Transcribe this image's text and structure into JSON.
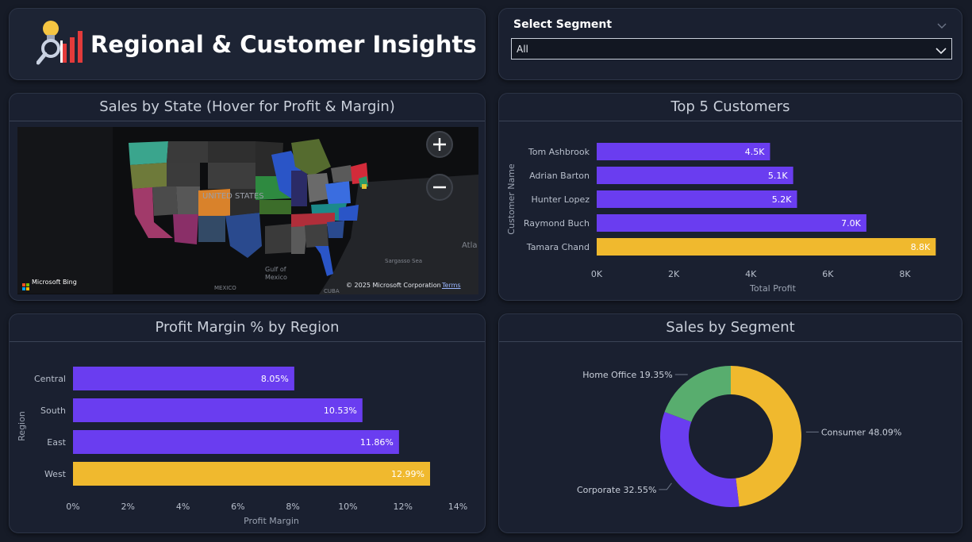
{
  "header": {
    "title": "Regional & Customer Insights",
    "logo_icon": "insights-logo-icon"
  },
  "slicer": {
    "label": "Select Segment",
    "value": "All",
    "icon": "chevron-down-icon"
  },
  "map": {
    "title": "Sales by State (Hover for Profit & Margin)",
    "labels": {
      "country": "UNITED STATES",
      "gulf": "Gulf of\nMexico",
      "mexico": "MEXICO",
      "cuba": "CUBA",
      "sargasso": "Sargasso Sea",
      "atlantic": "Atla"
    },
    "brand": "Microsoft Bing",
    "copyright": "© 2025 Microsoft Corporation",
    "terms": "Terms",
    "zoom_in_icon": "plus-icon",
    "zoom_out_icon": "minus-icon"
  },
  "chart_data": [
    {
      "type": "bar",
      "orientation": "horizontal",
      "title": "Top 5 Customers",
      "xlabel": "Total Profit",
      "ylabel": "Customer Name",
      "categories": [
        "Tom Ashbrook",
        "Adrian Barton",
        "Hunter Lopez",
        "Raymond Buch",
        "Tamara Chand"
      ],
      "values": [
        4500,
        5100,
        5200,
        7000,
        8800
      ],
      "data_labels": [
        "4.5K",
        "5.1K",
        "5.2K",
        "7.0K",
        "8.8K"
      ],
      "xlim": [
        0,
        9000
      ],
      "ticks": [
        0,
        2000,
        4000,
        6000,
        8000
      ],
      "tick_labels": [
        "0K",
        "2K",
        "4K",
        "6K",
        "8K"
      ],
      "colors": [
        "#6a3df0",
        "#6a3df0",
        "#6a3df0",
        "#6a3df0",
        "#f0b92e"
      ]
    },
    {
      "type": "bar",
      "orientation": "horizontal",
      "title": "Profit Margin % by Region",
      "xlabel": "Profit Margin",
      "ylabel": "Region",
      "categories": [
        "Central",
        "South",
        "East",
        "West"
      ],
      "values": [
        8.05,
        10.53,
        11.86,
        12.99
      ],
      "data_labels": [
        "8.05%",
        "10.53%",
        "11.86%",
        "12.99%"
      ],
      "xlim": [
        0,
        14
      ],
      "ticks": [
        0,
        2,
        4,
        6,
        8,
        10,
        12,
        14
      ],
      "tick_labels": [
        "0%",
        "2%",
        "4%",
        "6%",
        "8%",
        "10%",
        "12%",
        "14%"
      ],
      "colors": [
        "#6a3df0",
        "#6a3df0",
        "#6a3df0",
        "#f0b92e"
      ]
    },
    {
      "type": "pie",
      "variant": "donut",
      "title": "Sales by Segment",
      "categories": [
        "Consumer",
        "Corporate",
        "Home Office"
      ],
      "values": [
        48.09,
        32.55,
        19.35
      ],
      "data_labels": [
        "Consumer 48.09%",
        "Corporate 32.55%",
        "Home Office 19.35%"
      ],
      "colors": [
        "#f0b92e",
        "#6a3df0",
        "#58ad6e"
      ]
    }
  ]
}
